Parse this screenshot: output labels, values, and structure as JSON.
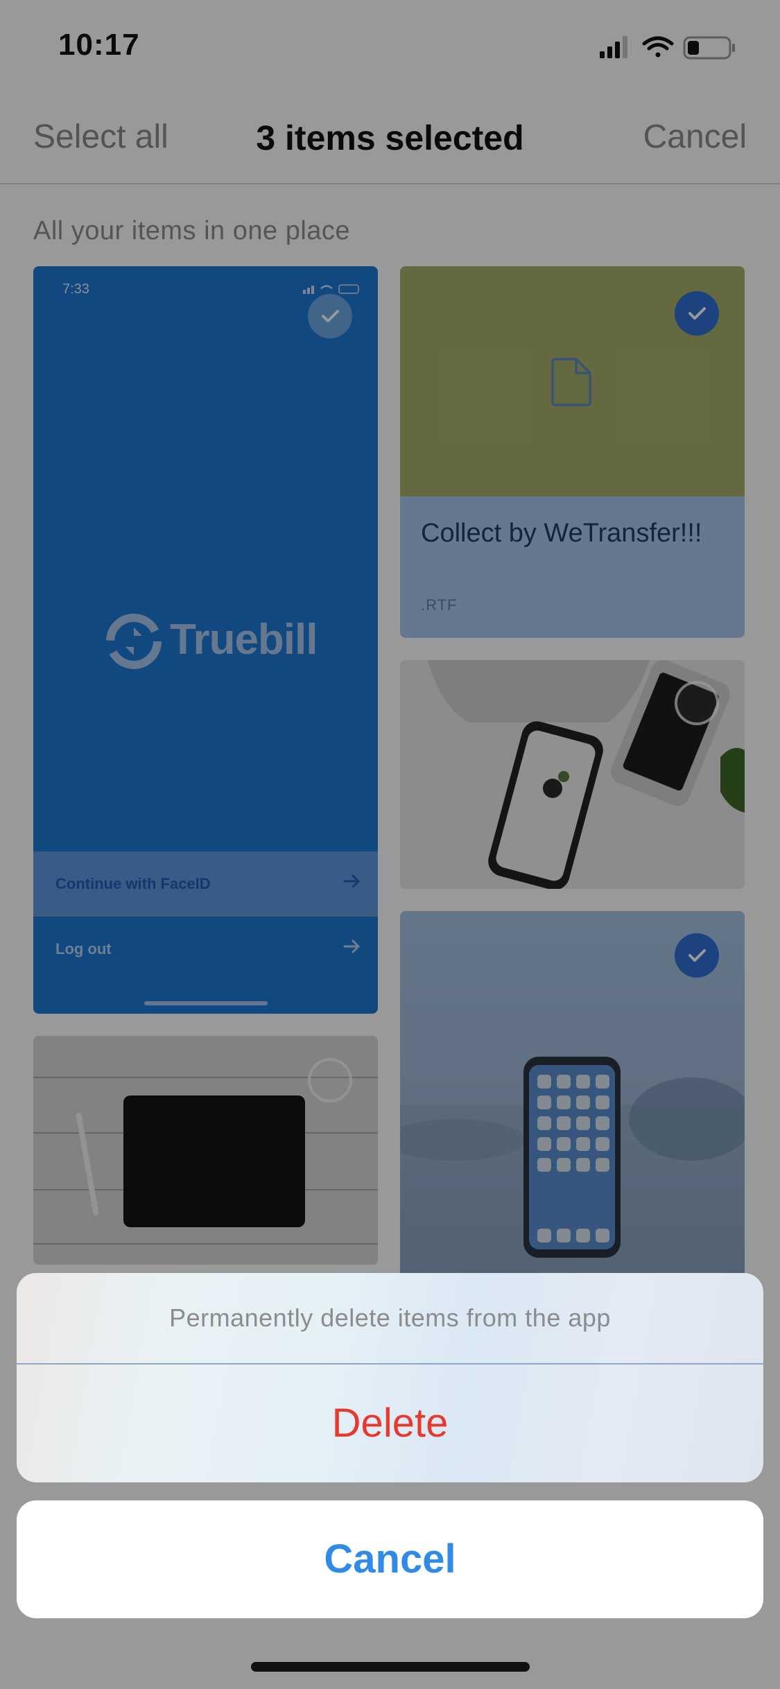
{
  "status_bar": {
    "time": "10:17"
  },
  "nav": {
    "left": "Select all",
    "title": "3 items selected",
    "right": "Cancel"
  },
  "section_title": "All your items in one place",
  "items": {
    "truebill": {
      "inner_time": "7:33",
      "logo": "Truebill",
      "continue_label": "Continue with FaceID",
      "logout_label": "Log out",
      "selected": false
    },
    "collect": {
      "title": "Collect by WeTransfer!!!",
      "ext": ".RTF",
      "selected": true
    },
    "desk_phones": {
      "selected": false
    },
    "tablet": {
      "selected": false
    },
    "bokeh_phone": {
      "selected": true
    }
  },
  "action_sheet": {
    "message": "Permanently delete items from the app",
    "delete_label": "Delete",
    "cancel_label": "Cancel"
  },
  "colors": {
    "accent": "#2f8be6",
    "destructive": "#e8392f",
    "selected": "#2f6fd6"
  }
}
